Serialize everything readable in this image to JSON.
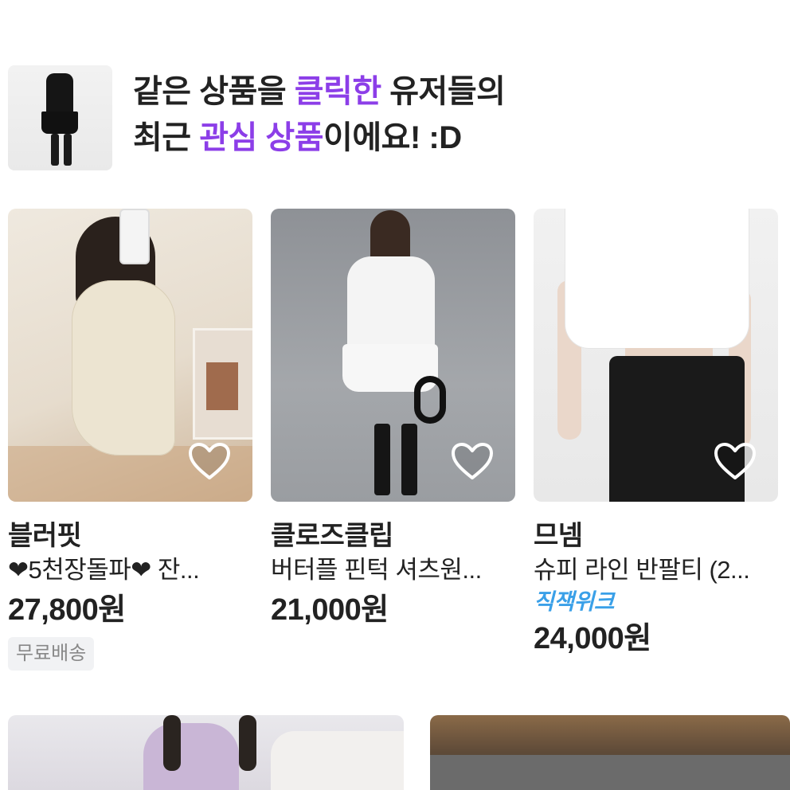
{
  "header": {
    "line1": {
      "a": "같은 상품을 ",
      "b": "클릭한",
      "c": " 유저들의"
    },
    "line2": {
      "a": "최근 ",
      "b": "관심 상품",
      "c": "이에요! :D"
    }
  },
  "products": [
    {
      "brand": "블러핏",
      "name": "❤5천장돌파❤ 잔...",
      "tag": "",
      "price": "27,800원",
      "badge": "무료배송",
      "wishlist_icon": "heart-outline-icon"
    },
    {
      "brand": "클로즈클립",
      "name": "버터플 핀턱 셔츠원...",
      "tag": "",
      "price": "21,000원",
      "badge": "",
      "wishlist_icon": "heart-outline-icon"
    },
    {
      "brand": "므넴",
      "name": "슈피 라인 반팔티 (2...",
      "tag": "직잭위크",
      "price": "24,000원",
      "badge": "",
      "wishlist_icon": "heart-outline-icon"
    }
  ],
  "colors": {
    "accent": "#8c3ee8",
    "tag": "#3aa0e8",
    "text": "#222222",
    "badge_bg": "#f1f2f4"
  }
}
